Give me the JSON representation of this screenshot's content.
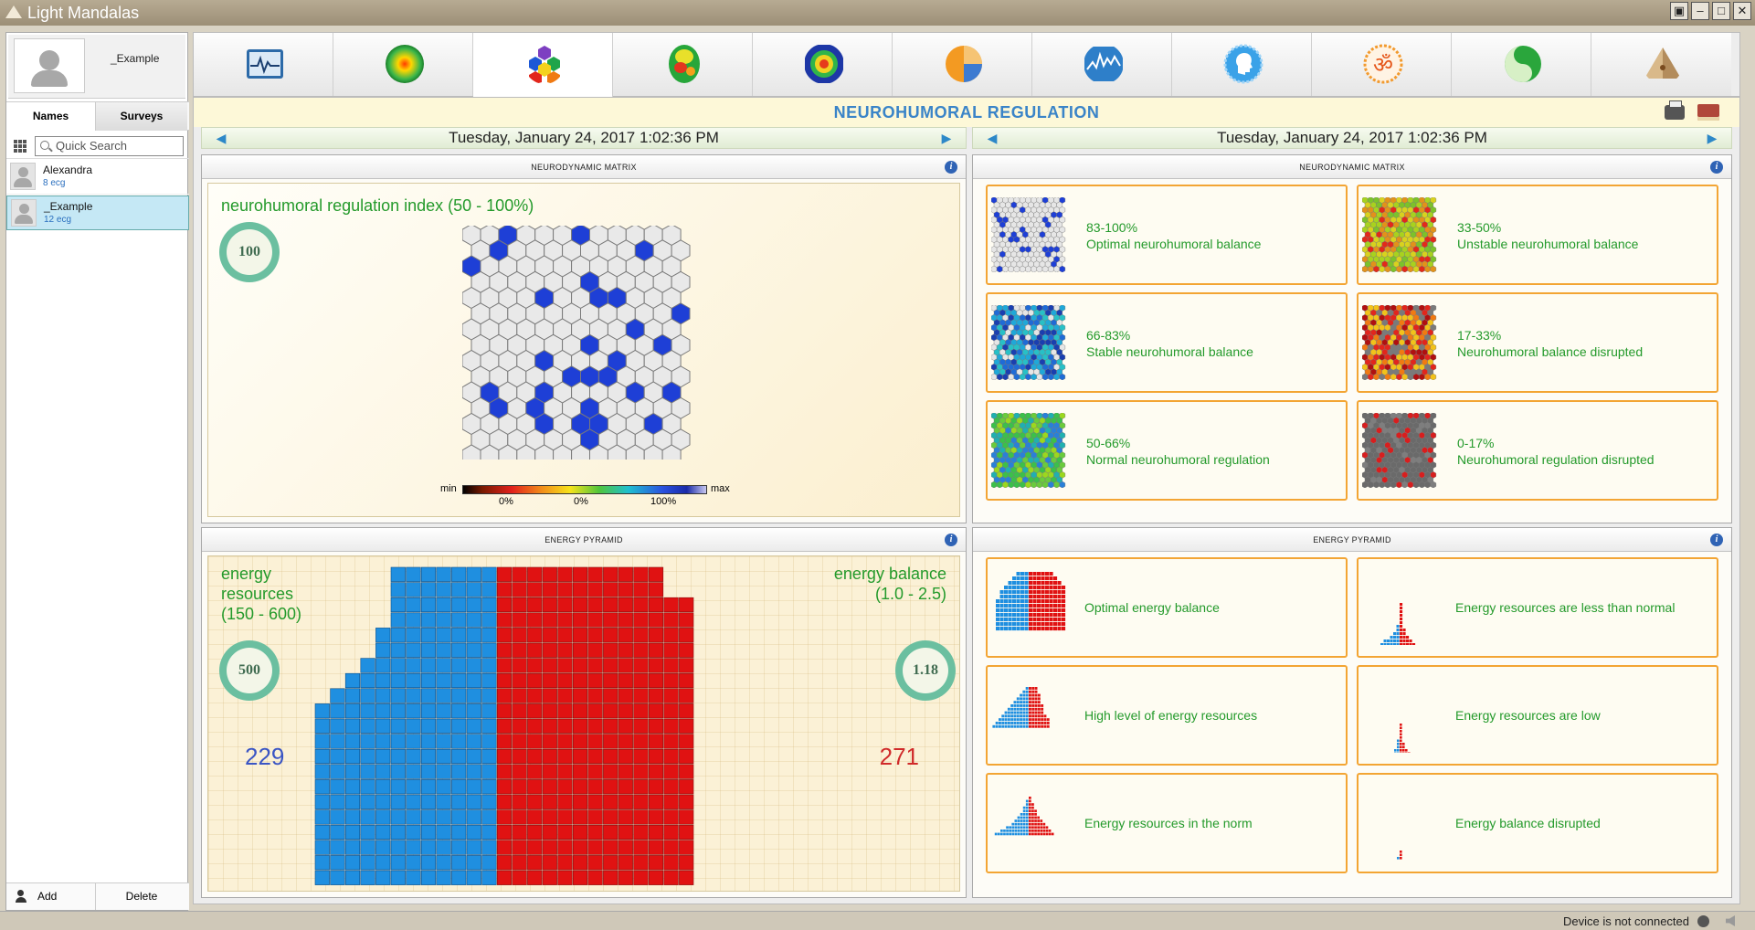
{
  "app": {
    "title": "Light Mandalas"
  },
  "window": {
    "restore": "▣",
    "minimize": "–",
    "maximize": "□",
    "close": "✕"
  },
  "sidebar": {
    "profile_name": "_Example",
    "tabs": [
      "Names",
      "Surveys"
    ],
    "search_placeholder": "Quick Search",
    "people": [
      {
        "name": "Alexandra",
        "count": "8 ecg",
        "selected": false
      },
      {
        "name": "_Example",
        "count": "12 ecg",
        "selected": true
      }
    ],
    "add_label": "Add",
    "delete_label": "Delete"
  },
  "toolbar": {
    "active_index": 2,
    "icons": [
      "ecg-chart-icon",
      "sphere-icon",
      "hexagon-cluster-icon",
      "brain-map-icon",
      "mandala-icon",
      "pie-chart-icon",
      "wave-chart-icon",
      "head-profile-icon",
      "om-icon",
      "yin-yang-icon",
      "pyramid-icon"
    ]
  },
  "page": {
    "title": "NEUROHUMORAL REGULATION"
  },
  "left_date": "Tuesday, January 24, 2017 1:02:36 PM",
  "right_date": "Tuesday, January 24, 2017 1:02:36 PM",
  "matrix_panel": {
    "header": "NEURODYNAMIC MATRIX",
    "label": "neurohumoral regulation index (50 - 100%)",
    "value": "100",
    "scale_min": "min",
    "scale_max": "max",
    "scale_ticks": [
      "0%",
      "0%",
      "100%"
    ],
    "highlight_color": "#1e3fd6"
  },
  "matrix_legend": {
    "header": "NEURODYNAMIC MATRIX",
    "cards": [
      {
        "range": "83-100%",
        "text": "Optimal neurohumoral balance"
      },
      {
        "range": "33-50%",
        "text": "Unstable neurohumoral balance"
      },
      {
        "range": "66-83%",
        "text": "Stable neurohumoral balance"
      },
      {
        "range": "17-33%",
        "text": "Neurohumoral balance disrupted"
      },
      {
        "range": "50-66%",
        "text": "Normal neurohumoral regulation"
      },
      {
        "range": "0-17%",
        "text": "Neurohumoral regulation disrupted"
      }
    ]
  },
  "pyramid_panel": {
    "header": "ENERGY PYRAMID",
    "left_label_1": "energy",
    "left_label_2": "resources",
    "left_label_3": "(150 - 600)",
    "right_label_1": "energy balance",
    "right_label_2": "(1.0 - 2.5)",
    "left_value": "500",
    "right_value": "1.18",
    "left_count": "229",
    "right_count": "271",
    "blue_color": "#1f8fe0",
    "red_color": "#e01212"
  },
  "pyramid_legend": {
    "header": "ENERGY PYRAMID",
    "cards": [
      "Optimal energy balance",
      "Energy resources are less than normal",
      "High level of energy resources",
      "Energy resources are low",
      "Energy resources in the norm",
      "Energy balance disrupted"
    ]
  },
  "status": {
    "text": "Device is not connected"
  }
}
